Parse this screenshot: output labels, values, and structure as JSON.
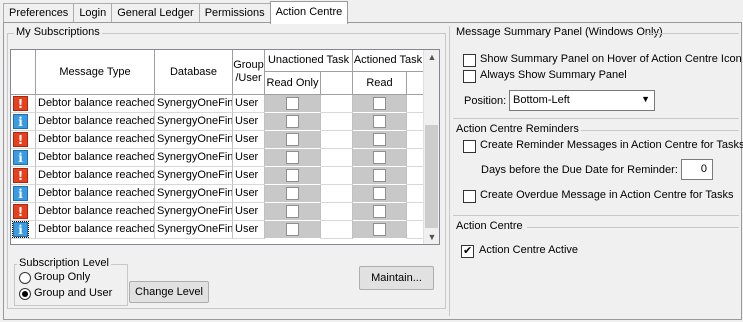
{
  "tabs": [
    "Preferences",
    "Login",
    "General Ledger",
    "Permissions",
    "Action Centre"
  ],
  "subscriptions": {
    "title": "My Subscriptions",
    "columns": {
      "message_type": "Message Type",
      "database": "Database",
      "group_user_1": "Group",
      "group_user_2": "/User",
      "unactioned": "Unactioned Task",
      "actioned": "Actioned Task",
      "read_only": "Read Only",
      "read": "Read"
    },
    "rows": [
      {
        "icon": "warning-icon",
        "message": "Debtor balance reached",
        "database": "SynergyOneFin",
        "type": "User"
      },
      {
        "icon": "info-icon",
        "message": "Debtor balance reached",
        "database": "SynergyOneFin",
        "type": "User"
      },
      {
        "icon": "warning-icon",
        "message": "Debtor balance reached",
        "database": "SynergyOneFin",
        "type": "User"
      },
      {
        "icon": "info-icon",
        "message": "Debtor balance reached",
        "database": "SynergyOneFin",
        "type": "User"
      },
      {
        "icon": "warning-icon",
        "message": "Debtor balance reached",
        "database": "SynergyOneFin",
        "type": "User"
      },
      {
        "icon": "info-icon",
        "message": "Debtor balance reached",
        "database": "SynergyOneFin",
        "type": "User"
      },
      {
        "icon": "warning-icon",
        "message": "Debtor balance reached",
        "database": "SynergyOneFin",
        "type": "User"
      },
      {
        "icon": "info-icon",
        "message": "Debtor balance reached",
        "database": "SynergyOneFin",
        "type": "User"
      }
    ],
    "subscription_level": {
      "title": "Subscription Level",
      "group_only": "Group Only",
      "group_and_user": "Group and User"
    },
    "change_level": "Change Level",
    "maintain": "Maintain..."
  },
  "summary_panel": {
    "title": "Message Summary Panel (Windows Only)",
    "show_on_hover": "Show Summary Panel on Hover of Action Centre Icon",
    "always_show": "Always Show Summary Panel",
    "position_label": "Position:",
    "position_value": "Bottom-Left"
  },
  "reminders": {
    "title": "Action Centre Reminders",
    "create_reminder": "Create Reminder Messages in Action Centre for Tasks",
    "days_label": "Days before the Due Date for Reminder:",
    "days_value": "0",
    "create_overdue": "Create Overdue Message in Action Centre for Tasks"
  },
  "action_centre": {
    "title": "Action Centre",
    "active": "Action Centre Active"
  },
  "colors": {
    "warning": "#e8401c",
    "info": "#3b9be0"
  }
}
